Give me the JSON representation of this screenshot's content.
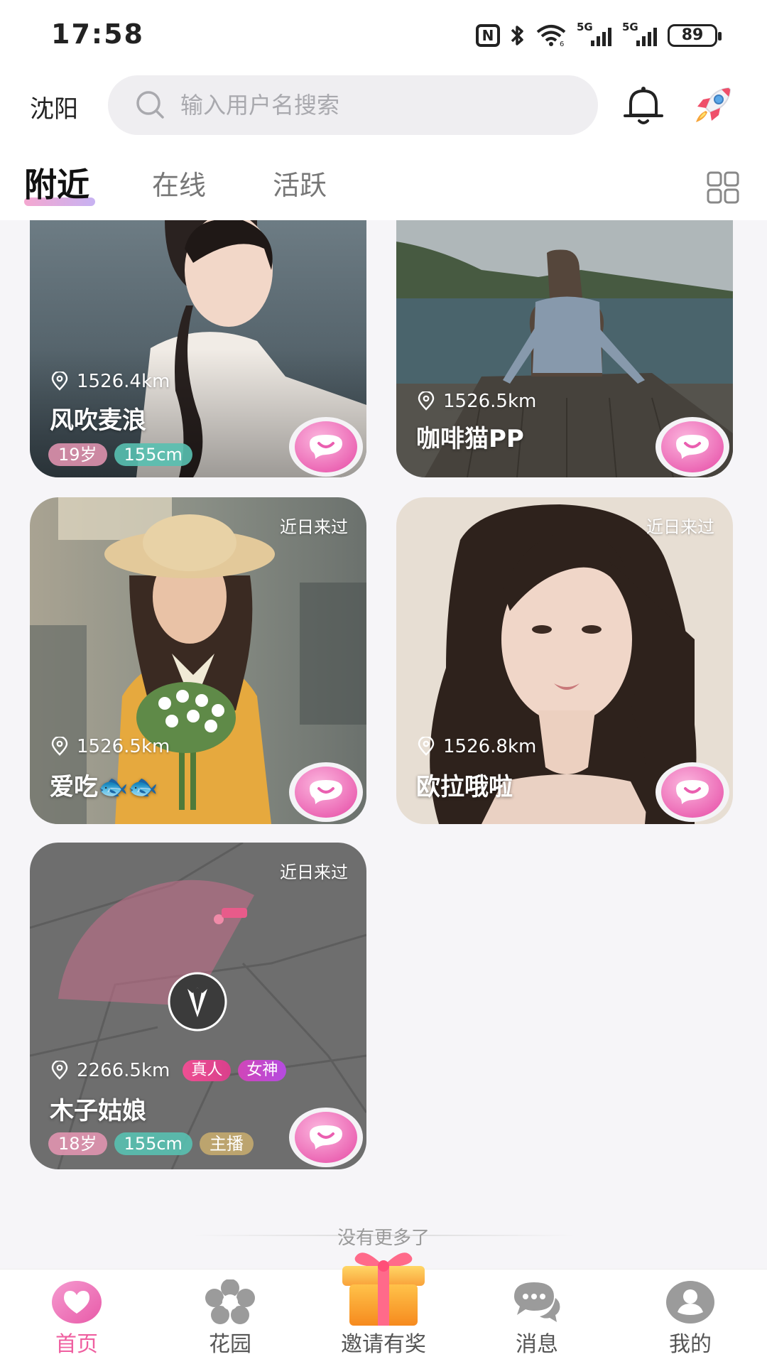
{
  "status_bar": {
    "time": "17:58",
    "nfc": "N",
    "signal1_label": "5G",
    "signal2_label": "5G",
    "battery": "89"
  },
  "header": {
    "city": "沈阳",
    "search_placeholder": "输入用户名搜索"
  },
  "tabs": [
    {
      "label": "附近",
      "active": true
    },
    {
      "label": "在线",
      "active": false
    },
    {
      "label": "活跃",
      "active": false
    }
  ],
  "cards": [
    {
      "distance": "1526.4km",
      "name": "风吹麦浪",
      "tags": [
        "19岁",
        "155cm"
      ]
    },
    {
      "distance": "1526.5km",
      "name": "咖啡猫PP"
    },
    {
      "recent": "近日来过",
      "distance": "1526.5km",
      "name": "爱吃🐟🐟"
    },
    {
      "recent": "近日来过",
      "distance": "1526.8km",
      "name": "欧拉哦啦"
    },
    {
      "recent": "近日来过",
      "distance": "2266.5km",
      "badges": [
        "真人",
        "女神"
      ],
      "name": "木子姑娘",
      "tags": [
        "18岁",
        "155cm",
        "主播"
      ]
    }
  ],
  "end_text": "没有更多了",
  "bottom_nav": [
    {
      "label": "首页",
      "active": true
    },
    {
      "label": "花园",
      "active": false
    },
    {
      "label": "邀请有奖",
      "active": false
    },
    {
      "label": "消息",
      "active": false
    },
    {
      "label": "我的",
      "active": false
    }
  ],
  "colors": {
    "accent_pink": "#ef5fa0",
    "chat_button": "#f07fc2",
    "tag_height": "#58c0b0",
    "tag_age": "#e896b4"
  }
}
